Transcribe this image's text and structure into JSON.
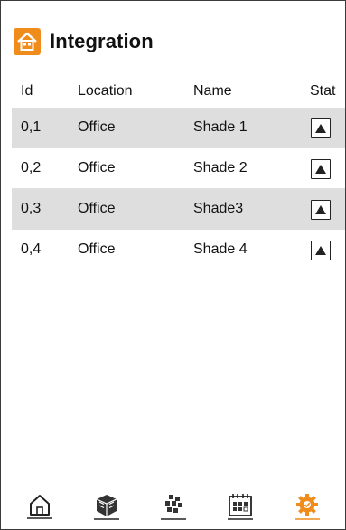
{
  "header": {
    "title": "Integration",
    "logo_icon": "orange-house-icon"
  },
  "table": {
    "columns": [
      "Id",
      "Location",
      "Name",
      "Stat"
    ],
    "rows": [
      {
        "id": "0,1",
        "location": "Office",
        "name": "Shade 1",
        "stat": "up-arrow-icon"
      },
      {
        "id": "0,2",
        "location": "Office",
        "name": "Shade 2",
        "stat": "up-arrow-icon"
      },
      {
        "id": "0,3",
        "location": "Office",
        "name": "Shade3",
        "stat": "up-arrow-icon"
      },
      {
        "id": "0,4",
        "location": "Office",
        "name": "Shade 4",
        "stat": "up-arrow-icon"
      }
    ]
  },
  "bottom_nav": [
    {
      "icon": "home-icon",
      "active": false
    },
    {
      "icon": "cube-box-icon",
      "active": false
    },
    {
      "icon": "device-cluster-icon",
      "active": false
    },
    {
      "icon": "calendar-icon",
      "active": false
    },
    {
      "icon": "gear-icon",
      "active": true
    }
  ],
  "colors": {
    "accent": "#f08c1c",
    "row_stripe": "#dedede",
    "text": "#111111"
  }
}
